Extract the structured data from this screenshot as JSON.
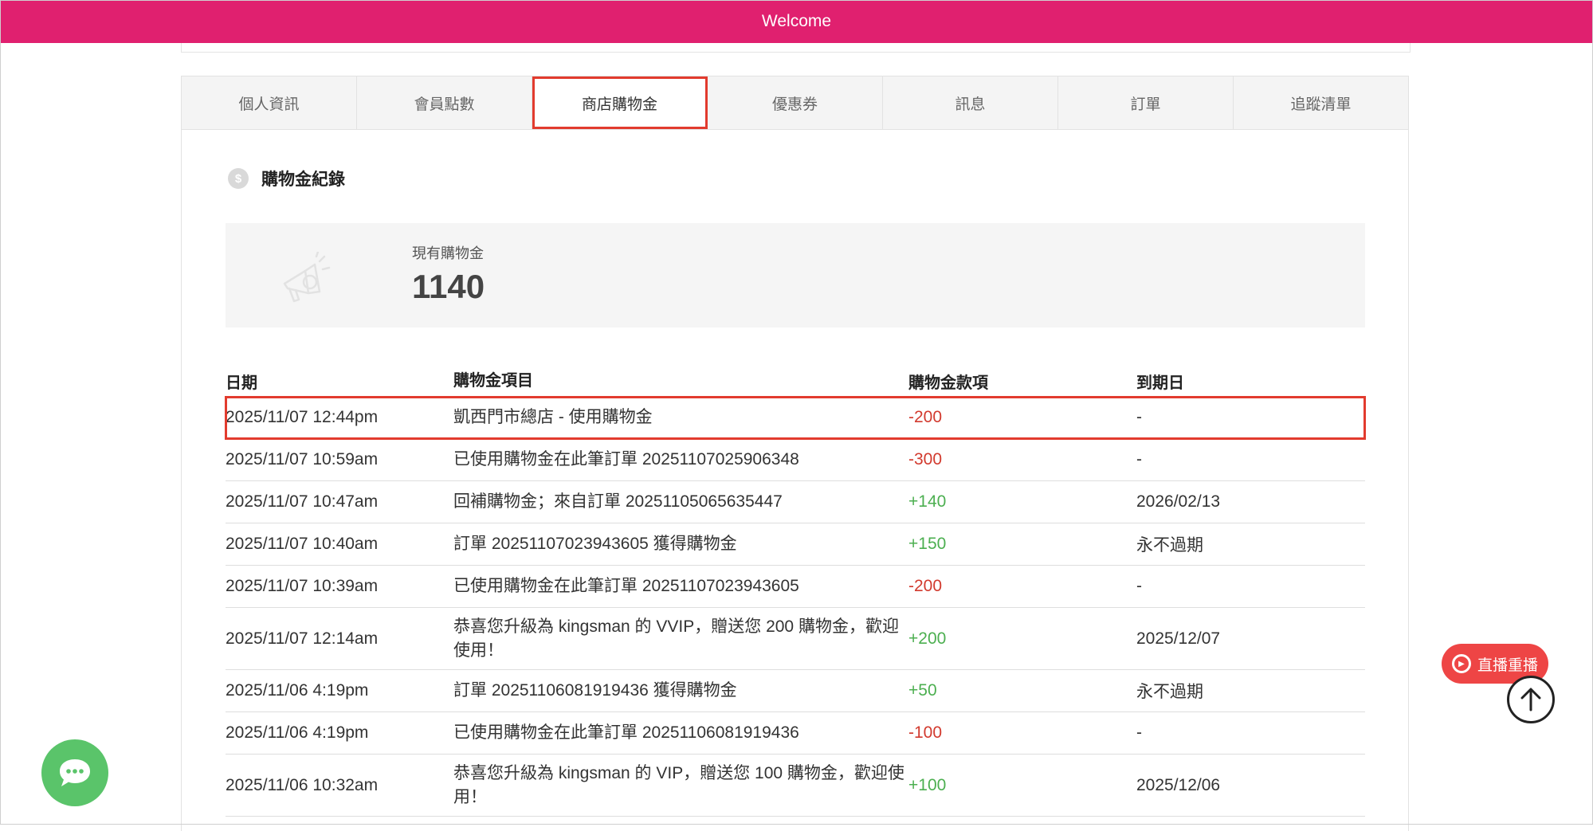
{
  "topbar": {
    "title": "Welcome"
  },
  "tabs": [
    {
      "label": "個人資訊"
    },
    {
      "label": "會員點數"
    },
    {
      "label": "商店購物金"
    },
    {
      "label": "優惠券"
    },
    {
      "label": "訊息"
    },
    {
      "label": "訂單"
    },
    {
      "label": "追蹤清單"
    }
  ],
  "section": {
    "title": "購物金紀錄",
    "icon": "dollar-coin-icon"
  },
  "balance": {
    "label": "現有購物金",
    "value": "1140",
    "icon": "megaphone-icon"
  },
  "table": {
    "headers": [
      "日期",
      "購物金項目",
      "購物金款項",
      "到期日"
    ],
    "rows": [
      {
        "date": "2025/11/07 12:44pm",
        "item": "凱西門市總店 - 使用購物金",
        "amount": "-200",
        "expiry": "-"
      },
      {
        "date": "2025/11/07 10:59am",
        "item": "已使用購物金在此筆訂單 20251107025906348",
        "amount": "-300",
        "expiry": "-"
      },
      {
        "date": "2025/11/07 10:47am",
        "item": "回補購物金；來自訂單 20251105065635447",
        "amount": "+140",
        "expiry": "2026/02/13"
      },
      {
        "date": "2025/11/07 10:40am",
        "item": "訂單 20251107023943605 獲得購物金",
        "amount": "+150",
        "expiry": "永不過期"
      },
      {
        "date": "2025/11/07 10:39am",
        "item": "已使用購物金在此筆訂單 20251107023943605",
        "amount": "-200",
        "expiry": "-"
      },
      {
        "date": "2025/11/07 12:14am",
        "item": "恭喜您升級為 kingsman 的 VVIP，贈送您 200 購物金，歡迎使用！",
        "amount": "+200",
        "expiry": "2025/12/07"
      },
      {
        "date": "2025/11/06 4:19pm",
        "item": "訂單 20251106081919436 獲得購物金",
        "amount": "+50",
        "expiry": "永不過期"
      },
      {
        "date": "2025/11/06 4:19pm",
        "item": "已使用購物金在此筆訂單 20251106081919436",
        "amount": "-100",
        "expiry": "-"
      },
      {
        "date": "2025/11/06 10:32am",
        "item": "恭喜您升級為 kingsman 的 VIP，贈送您 100 購物金，歡迎使用！",
        "amount": "+100",
        "expiry": "2025/12/06"
      }
    ]
  },
  "floating": {
    "live_label": "直播重播",
    "live_icon": "play-circle-icon",
    "top_icon": "arrow-up-icon",
    "chat_icon": "chat-bubble-icon"
  },
  "colors": {
    "brand": "#e0206f",
    "highlight": "#e23b2e",
    "negative": "#d23a2e",
    "positive": "#4caf50",
    "chat": "#5ac46a",
    "live": "#ee4545"
  }
}
